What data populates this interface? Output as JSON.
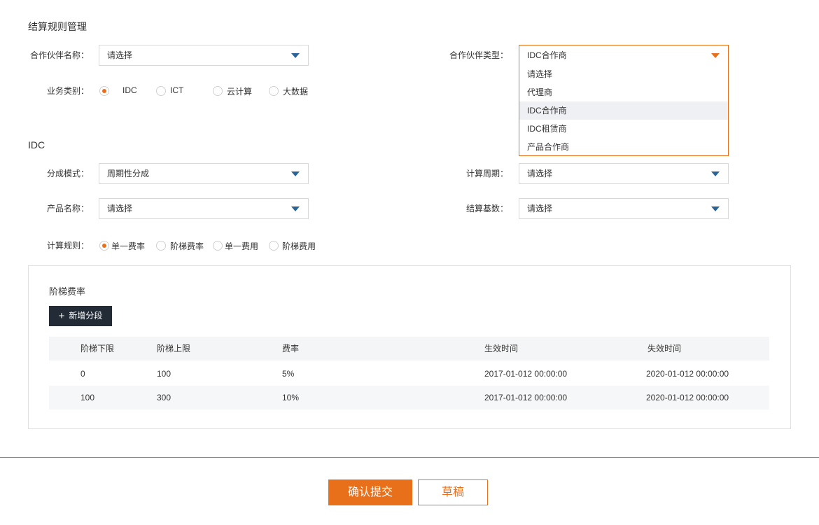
{
  "page_title": "结算规则管理",
  "partner_name": {
    "label": "合作伙伴名称：",
    "value": "请选择"
  },
  "partner_type": {
    "label": "合作伙伴类型：",
    "value": "IDC合作商",
    "options": [
      "请选择",
      "代理商",
      "IDC合作商",
      "IDC租赁商",
      "产品合作商"
    ]
  },
  "business_type": {
    "label": "业务类别：",
    "options": [
      "IDC",
      "ICT",
      "云计算",
      "大数据"
    ],
    "selected": "IDC"
  },
  "idc_section": {
    "title": "IDC",
    "split_mode": {
      "label": "分成模式：",
      "value": "周期性分成"
    },
    "calc_period": {
      "label": "计算周期：",
      "value": "请选择"
    },
    "product_name": {
      "label": "产品名称：",
      "value": "请选择"
    },
    "settle_base": {
      "label": "结算基数：",
      "value": "请选择"
    },
    "calc_rule": {
      "label": "计算规则：",
      "options": [
        "单一费率",
        "阶梯费率",
        "单一费用",
        "阶梯费用"
      ],
      "selected": "单一费率"
    }
  },
  "tier_panel": {
    "title": "阶梯费率",
    "add_button": "新增分段",
    "columns": [
      "阶梯下限",
      "阶梯上限",
      "费率",
      "生效时间",
      "失效时间"
    ],
    "rows": [
      [
        "0",
        "100",
        "5%",
        "2017-01-012 00:00:00",
        "2020-01-012 00:00:00"
      ],
      [
        "100",
        "300",
        "10%",
        "2017-01-012 00:00:00",
        "2020-01-012 00:00:00"
      ]
    ]
  },
  "footer": {
    "submit": "确认提交",
    "draft": "草稿"
  },
  "colors": {
    "accent": "#e8701a",
    "dark_button": "#222b36",
    "caret": "#2a6496"
  }
}
